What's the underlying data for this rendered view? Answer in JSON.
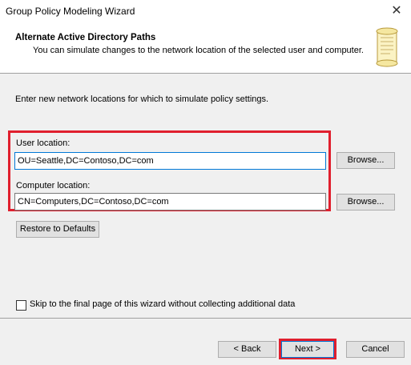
{
  "window": {
    "title": "Group Policy Modeling Wizard",
    "close_glyph": "✕"
  },
  "header": {
    "title": "Alternate Active Directory Paths",
    "subtitle": "You can simulate changes to the network location of the selected user and computer.",
    "icon": "scroll-icon"
  },
  "content": {
    "instruction": "Enter new network locations for which to simulate policy settings.",
    "user_location": {
      "label": "User location:",
      "value": "OU=Seattle,DC=Contoso,DC=com",
      "browse_label": "Browse..."
    },
    "computer_location": {
      "label": "Computer location:",
      "value": "CN=Computers,DC=Contoso,DC=com",
      "browse_label": "Browse..."
    },
    "restore_label": "Restore to Defaults",
    "skip_checkbox": {
      "label": "Skip to the final page of this wizard without collecting additional data",
      "checked": false
    }
  },
  "footer": {
    "back_label": "< Back",
    "next_label": "Next >",
    "cancel_label": "Cancel"
  },
  "colors": {
    "highlight": "#e01f2e",
    "focus_border": "#0078d7",
    "button_face": "#e1e1e1"
  }
}
